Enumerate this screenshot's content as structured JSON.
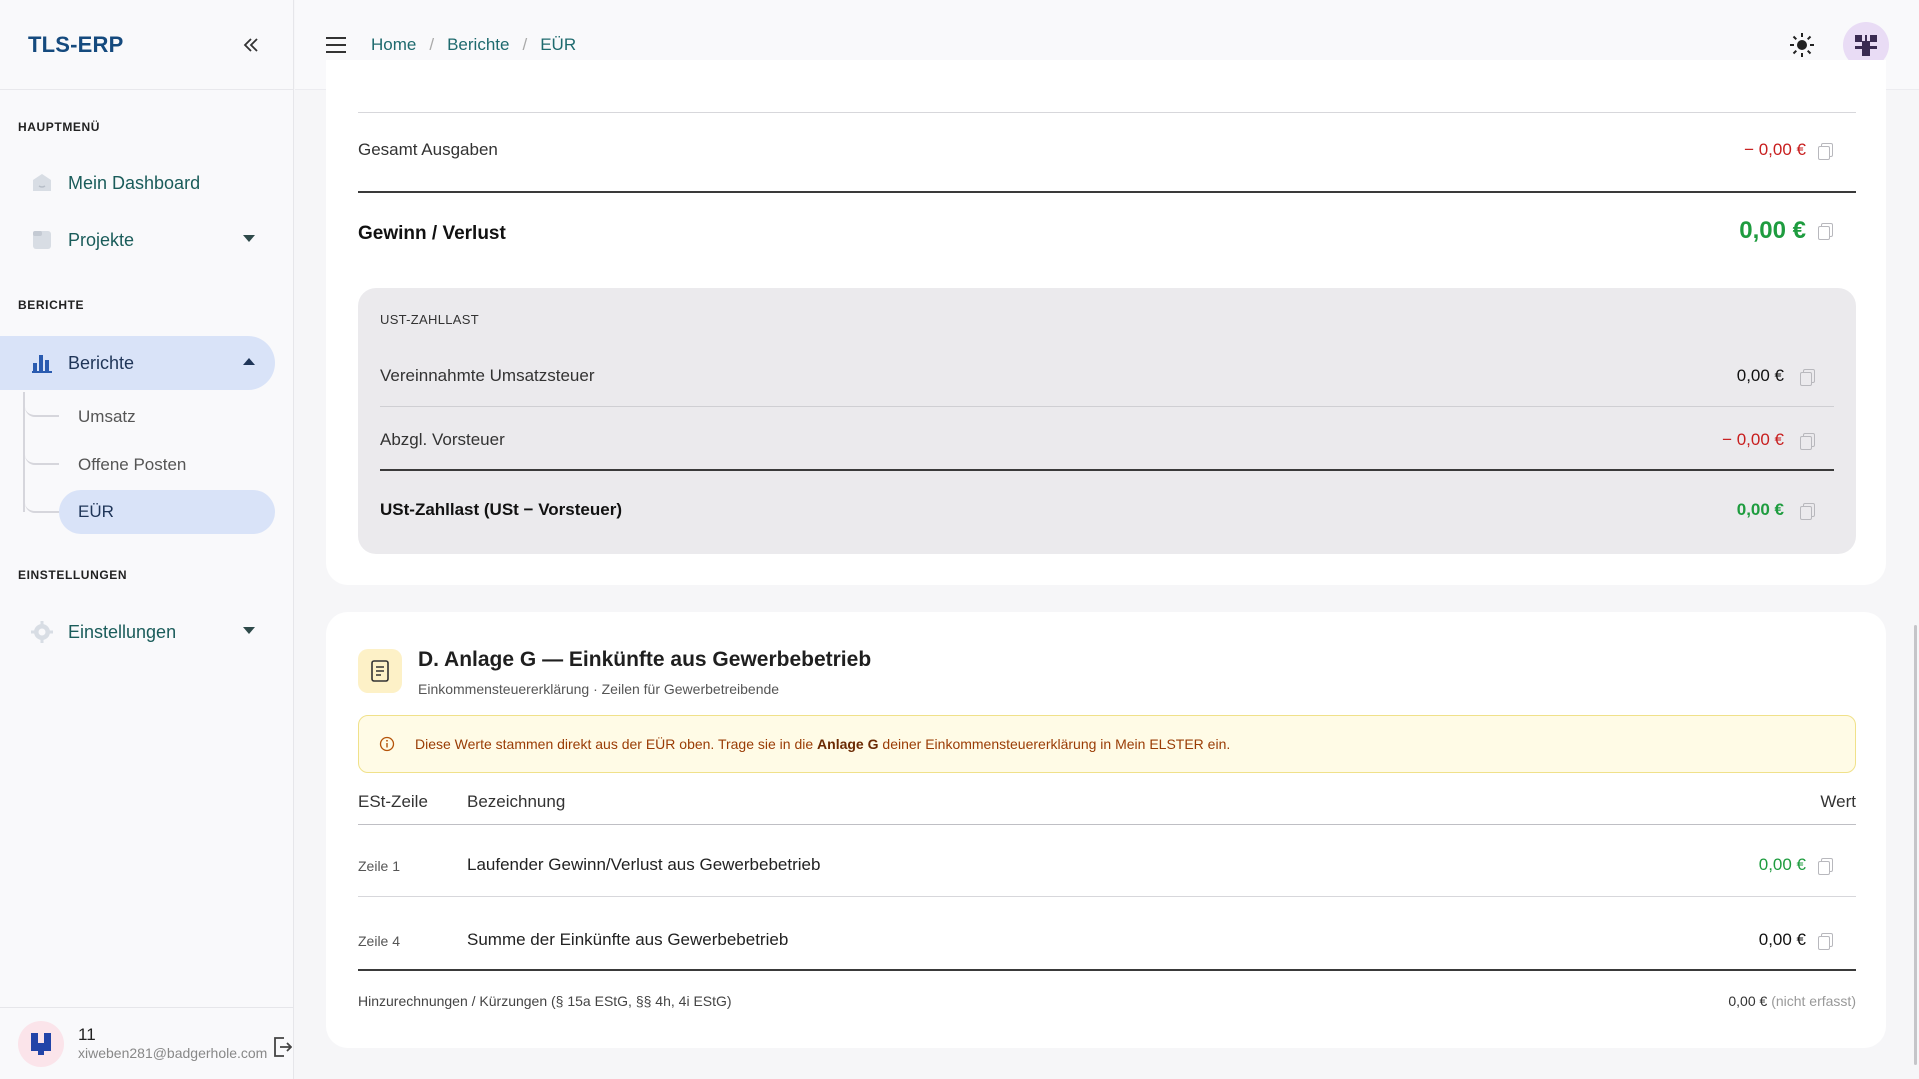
{
  "app": {
    "brand": "TLS-ERP"
  },
  "sidebar": {
    "sections": {
      "main": "HAUPTMENÜ",
      "reports": "BERICHTE",
      "settings": "EINSTELLUNGEN"
    },
    "items": {
      "dashboard": "Mein Dashboard",
      "projects": "Projekte",
      "reports": "Berichte",
      "settings": "Einstellungen"
    },
    "sub_items": [
      "Umsatz",
      "Offene Posten",
      "EÜR"
    ],
    "user": {
      "name": "11",
      "email": "xiweben281@badgerhole.com"
    }
  },
  "breadcrumb": [
    "Home",
    "Berichte",
    "EÜR"
  ],
  "summary": {
    "total_expenses": {
      "label": "Gesamt Ausgaben",
      "value": "− 0,00 €"
    },
    "profit_loss": {
      "label": "Gewinn / Verlust",
      "value": "0,00 €"
    }
  },
  "ust": {
    "title": "UST-ZAHLLAST",
    "rows": [
      {
        "label": "Vereinnahmte Umsatzsteuer",
        "value": "0,00 €"
      },
      {
        "label": "Abzgl. Vorsteuer",
        "value": "− 0,00 €"
      }
    ],
    "total": {
      "label": "USt-Zahllast (USt − Vorsteuer)",
      "value": "0,00 €"
    }
  },
  "anlage_g": {
    "title": "D. Anlage G — Einkünfte aus Gewerbebetrieb",
    "subtitle": "Einkommensteuererklärung · Zeilen für Gewerbetreibende",
    "notice": {
      "pre": "Diese Werte stammen direkt aus der EÜR oben. Trage sie in die",
      "bold": "Anlage G",
      "post": "deiner Einkommensteuererklärung in Mein ELSTER ein."
    },
    "columns": {
      "line": "ESt-Zeile",
      "desc": "Bezeichnung",
      "value": "Wert"
    },
    "rows": [
      {
        "line": "Zeile 1",
        "desc": "Laufender Gewinn/Verlust aus Gewerbebetrieb",
        "value": "0,00 €"
      },
      {
        "line": "Zeile 4",
        "desc": "Summe der Einkünfte aus Gewerbebetrieb",
        "value": "0,00 €"
      }
    ],
    "footer": {
      "label": "Hinzurechnungen / Kürzungen (§ 15a EStG, §§ 4h, 4i EStG)",
      "value": "0,00 €",
      "note": "(nicht erfasst)"
    }
  },
  "colors": {
    "brand": "#154a7e",
    "accent": "#1e6a6e",
    "positive": "#1e9c3f",
    "negative": "#c81e1e",
    "active_bg": "#d9e3f8"
  },
  "icons": [
    "collapse-sidebar-icon",
    "menu-icon",
    "sun-icon",
    "avatar-icon",
    "dashboard-icon",
    "projects-icon",
    "bar-chart-icon",
    "gear-icon",
    "copy-icon",
    "document-icon",
    "info-icon",
    "logout-icon"
  ]
}
